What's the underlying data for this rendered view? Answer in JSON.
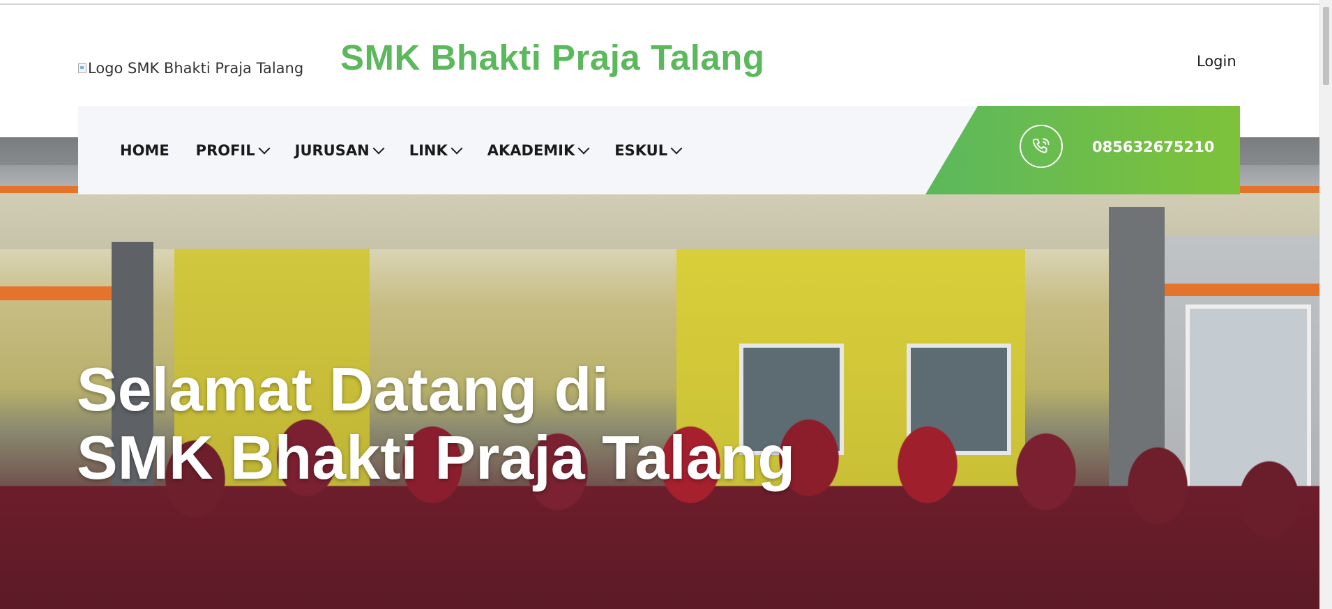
{
  "header": {
    "logo_alt": "Logo SMK Bhakti Praja Talang",
    "site_title": "SMK Bhakti Praja Talang",
    "login_label": "Login"
  },
  "nav": {
    "items": [
      {
        "label": "HOME",
        "dropdown": false
      },
      {
        "label": "PROFIL",
        "dropdown": true
      },
      {
        "label": "JURUSAN",
        "dropdown": true
      },
      {
        "label": "LINK",
        "dropdown": true
      },
      {
        "label": "AKADEMIK",
        "dropdown": true
      },
      {
        "label": "ESKUL",
        "dropdown": true
      }
    ],
    "phone_icon": "phone-icon",
    "phone_number": "085632675210"
  },
  "hero": {
    "title_line1": "Selamat Datang di",
    "title_line2": "SMK Bhakti Praja Talang"
  },
  "colors": {
    "brand_green": "#5cb85c",
    "accent_lime": "#7ec23a",
    "nav_bg": "#f5f6f9"
  }
}
